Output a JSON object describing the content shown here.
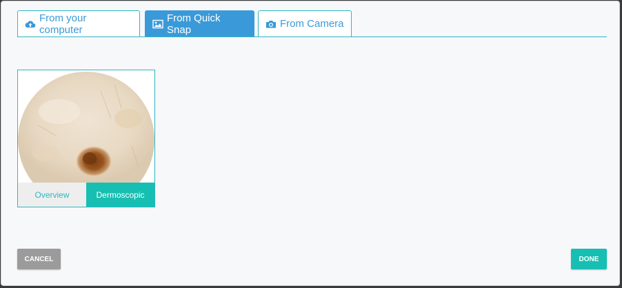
{
  "tabs": [
    {
      "label": "From your computer",
      "icon": "cloud-upload-icon",
      "active": false
    },
    {
      "label": "From Quick Snap",
      "icon": "image-icon",
      "active": true
    },
    {
      "label": "From Camera",
      "icon": "camera-icon",
      "active": false
    }
  ],
  "card": {
    "overview_label": "Overview",
    "dermoscopic_label": "Dermoscopic",
    "selected": "Dermoscopic"
  },
  "buttons": {
    "cancel_label": "CANCEL",
    "done_label": "DONE"
  },
  "colors": {
    "accent_blue": "#3a9ad9",
    "teal": "#17bfb2",
    "border_teal": "#2bb7c2",
    "cancel_gray": "#9b9b9b"
  }
}
